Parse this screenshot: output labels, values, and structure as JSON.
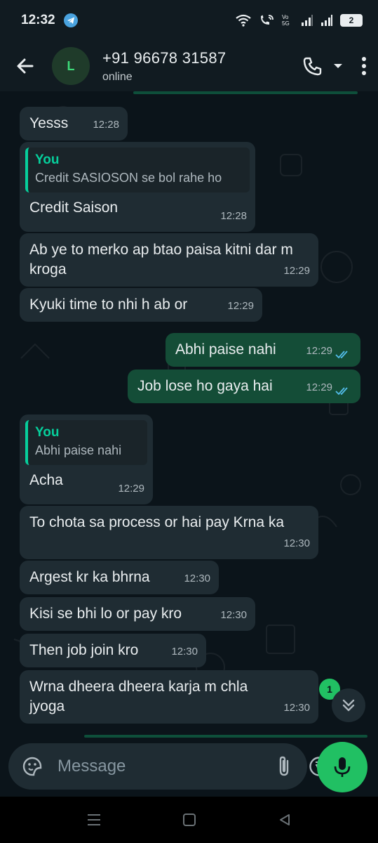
{
  "status_bar": {
    "time": "12:32",
    "battery": "2",
    "icons": [
      "telegram-icon",
      "wifi-icon",
      "wifi-calling-icon",
      "volte-icon",
      "signal-icon",
      "signal-icon",
      "battery-icon"
    ]
  },
  "header": {
    "avatar_letter": "L",
    "contact_name": "+91 96678 31587",
    "status": "online",
    "icons": [
      "back-arrow-icon",
      "phone-icon",
      "dropdown-arrow-icon",
      "more-vert-icon"
    ]
  },
  "messages": [
    {
      "dir": "in",
      "text": "Yesss",
      "time": "12:28"
    },
    {
      "dir": "in",
      "quote_author": "You",
      "quote_text": "Credit SASIOSON se bol rahe ho",
      "text": "Credit Saison",
      "time": "12:28"
    },
    {
      "dir": "in",
      "text": "Ab ye to merko ap btao paisa kitni dar m kroga",
      "time": "12:29"
    },
    {
      "dir": "in",
      "text": "Kyuki time to nhi h ab or",
      "time": "12:29"
    },
    {
      "dir": "out",
      "text": "Abhi paise nahi",
      "time": "12:29",
      "status": "read"
    },
    {
      "dir": "out",
      "text": "Job lose ho gaya hai",
      "time": "12:29",
      "status": "read"
    },
    {
      "dir": "in",
      "quote_author": "You",
      "quote_text": "Abhi paise nahi",
      "text": "Acha",
      "time": "12:29"
    },
    {
      "dir": "in",
      "text": "To chota sa process or hai pay Krna ka",
      "time": "12:30"
    },
    {
      "dir": "in",
      "text": "Argest kr ka bhrna",
      "time": "12:30"
    },
    {
      "dir": "in",
      "text": "Kisi se bhi lo or pay kro",
      "time": "12:30"
    },
    {
      "dir": "in",
      "text": "Then job join kro",
      "time": "12:30"
    },
    {
      "dir": "in",
      "text": "Wrna dheera dheera karja m chla jyoga",
      "time": "12:30"
    }
  ],
  "unread_count": "1",
  "composer": {
    "placeholder": "Message",
    "icons": [
      "sticker-icon",
      "attach-icon",
      "rupee-icon",
      "camera-icon",
      "mic-icon"
    ]
  },
  "colors": {
    "background": "#0b141a",
    "incoming_bubble": "#1f2c33",
    "outgoing_bubble": "#144d37",
    "accent": "#21c063",
    "quote_accent": "#06cf9c",
    "read_ticks": "#53bdeb"
  }
}
